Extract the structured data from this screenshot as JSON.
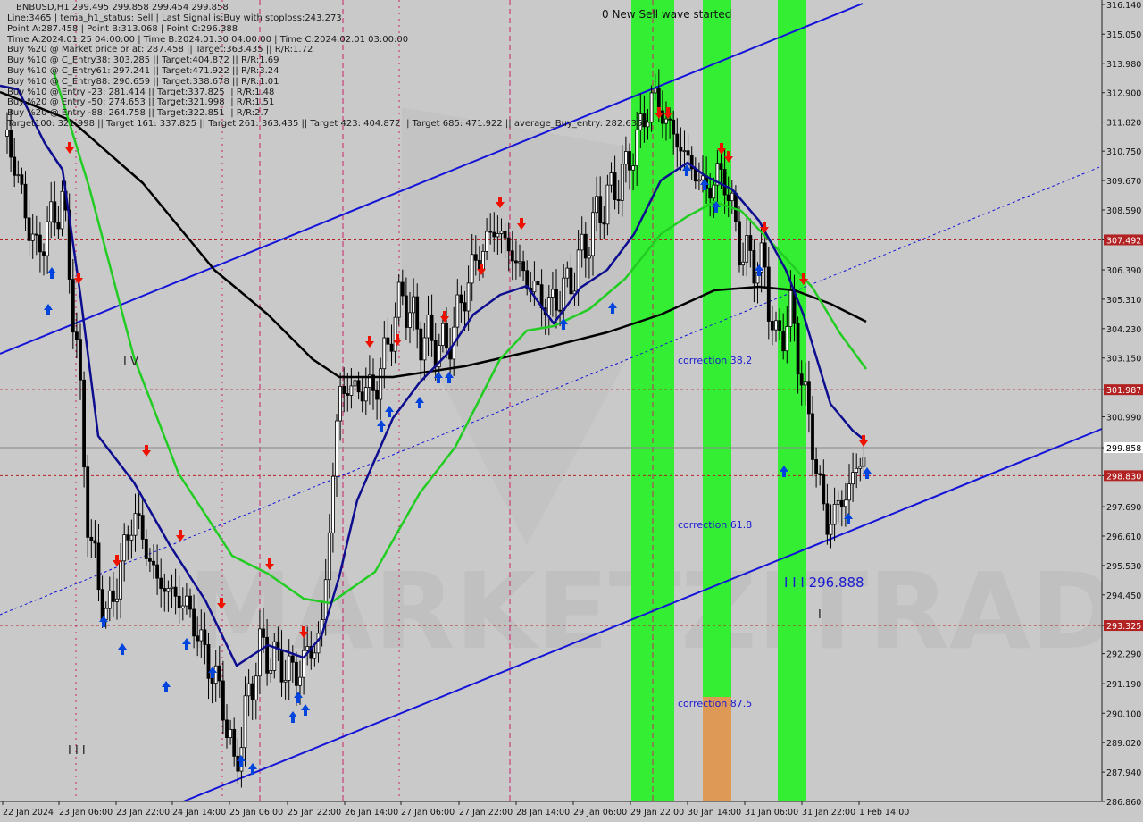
{
  "header": {
    "symbol_line": "BNBUSD,H1  299.495 299.858 299.454 299.858",
    "lines": [
      "Line:3465 | tema_h1_status: Sell | Last Signal is:Buy with stoploss:243.273",
      "Point A:287.458 | Point B:313.068 | Point C:296.388",
      "Time A:2024.01.25 04:00:00 | Time B:2024.01.30 04:00:00 | Time C:2024.02.01 03:00:00",
      "Buy %20 @ Market price or at: 287.458 || Target:363.435 || R/R:1.72",
      "Buy %10 @ C_Entry38: 303.285 || Target:404.872 || R/R:1.69",
      "Buy %10 @ C_Entry61: 297.241 || Target:471.922 || R/R:3.24",
      "Buy %10 @ C_Entry88: 290.659 || Target:338.678 || R/R:1.01",
      "Buy %10 @ Entry -23: 281.414 || Target:337.825 || R/R:1.48",
      "Buy %20 @ Entry -50: 274.653 || Target:321.998 || R/R:1.51",
      "Buy %20 @ Entry -88: 264.758 || Target:322.851 || R/R:2.7",
      "Target100: 321.998 || Target 161: 337.825 || Target 261: 363.435 || Target 423: 404.872 || Target 685: 471.922 || average_Buy_entry: 282.6357"
    ]
  },
  "annotations": {
    "wave_started": "0 New Sell wave started",
    "correction_38": "correction 38.2",
    "correction_61": "correction 61.8",
    "correction_87": "correction 87.5",
    "wave_label_iv": "I V",
    "wave_label_iii": "I I I",
    "point_c_label": "I I I 296.888",
    "wave_mark_small": "I"
  },
  "colors": {
    "background": "#c9c9c9",
    "ma_blue": "#0d0d8f",
    "ma_green": "#22cc22",
    "ma_black": "#000000",
    "channel": "#1414d8",
    "zone_green": "#33ee33",
    "zone_orange": "#dd9955",
    "level_red": "#b22222",
    "buy_arrow": "#0044dd",
    "sell_arrow": "#ee1100",
    "watermark": "#b8b8b8"
  },
  "chart_data": {
    "type": "candlestick",
    "symbol": "BNBUSD",
    "timeframe": "H1",
    "x_ticks": [
      "22 Jan 2024",
      "23 Jan 06:00",
      "23 Jan 22:00",
      "24 Jan 14:00",
      "25 Jan 06:00",
      "25 Jan 22:00",
      "26 Jan 14:00",
      "27 Jan 06:00",
      "27 Jan 22:00",
      "28 Jan 14:00",
      "29 Jan 06:00",
      "29 Jan 22:00",
      "30 Jan 14:00",
      "31 Jan 06:00",
      "31 Jan 22:00",
      "1 Feb 14:00"
    ],
    "y_ticks": [
      "316.140",
      "315.050",
      "313.980",
      "312.900",
      "311.820",
      "310.750",
      "309.670",
      "308.590",
      "307.492",
      "306.390",
      "305.310",
      "304.230",
      "303.150",
      "301.987",
      "300.990",
      "299.858",
      "298.830",
      "297.690",
      "296.610",
      "295.530",
      "294.450",
      "293.325",
      "292.290",
      "291.190",
      "290.100",
      "289.020",
      "287.940",
      "286.860"
    ],
    "ylim": [
      286.86,
      316.14
    ],
    "levels": [
      {
        "value": 307.492,
        "label": "307.492",
        "style": "dotted-red"
      },
      {
        "value": 301.987,
        "label": "301.987",
        "style": "dotted-red"
      },
      {
        "value": 299.858,
        "label": "299.858",
        "style": "current-price"
      },
      {
        "value": 298.83,
        "label": "298.830",
        "style": "dotted-red"
      },
      {
        "value": 293.325,
        "label": "293.325",
        "style": "dotted-red"
      }
    ],
    "series": [
      {
        "name": "tema",
        "color": "#0d0d8f"
      },
      {
        "name": "ma_fast",
        "color": "#22cc22"
      },
      {
        "name": "ma_slow",
        "color": "#000000"
      }
    ]
  },
  "watermark": "MARKETZITRADE"
}
